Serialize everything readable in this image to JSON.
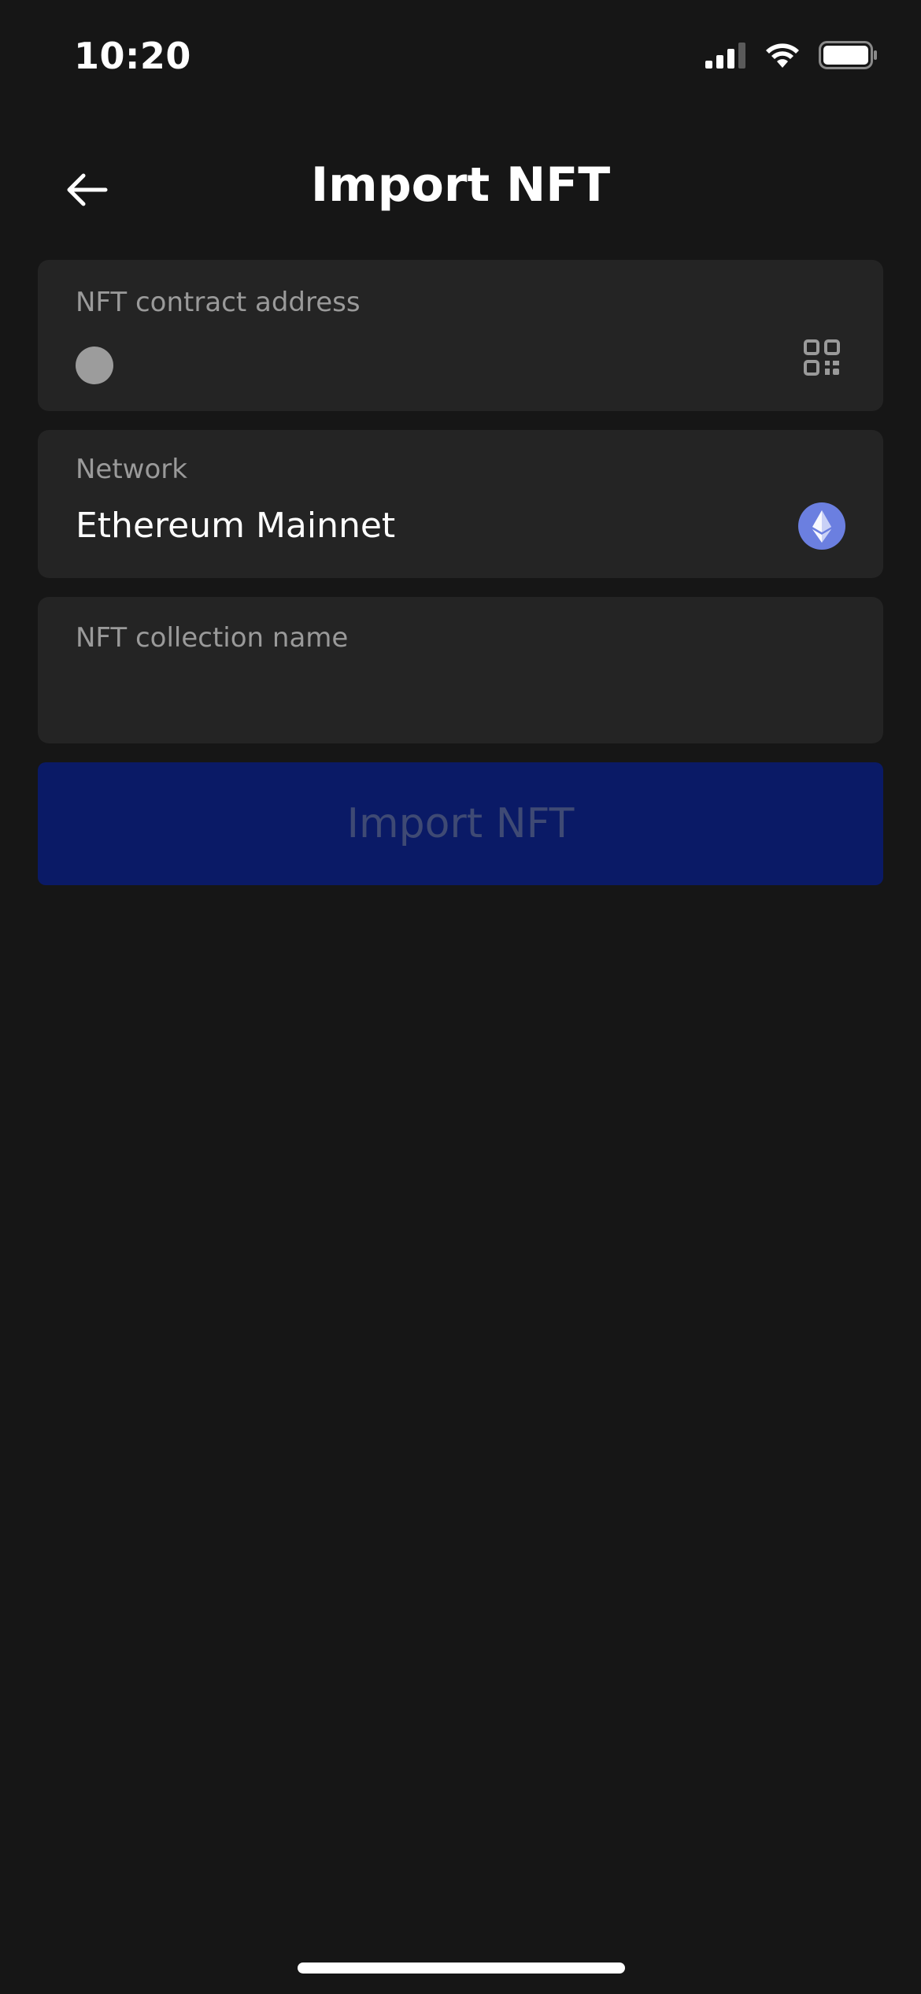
{
  "status_bar": {
    "time": "10:20",
    "icons": [
      "cellular-signal-icon",
      "wifi-icon",
      "battery-icon"
    ]
  },
  "header": {
    "title": "Import NFT",
    "back_icon": "arrow-left-icon"
  },
  "form": {
    "contract_address": {
      "label": "NFT contract address",
      "value": "",
      "scan_icon": "qr-code-icon"
    },
    "network": {
      "label": "Network",
      "value": "Ethereum Mainnet",
      "icon": "ethereum-icon"
    },
    "collection_name": {
      "label": "NFT collection name",
      "value": ""
    },
    "submit_label": "Import NFT"
  },
  "colors": {
    "background": "#161616",
    "field_background": "#242424",
    "label": "#9a9a9a",
    "button_background": "#0a1a66",
    "button_text_disabled": "#3f4a74",
    "ethereum": "#6b7fe0"
  }
}
